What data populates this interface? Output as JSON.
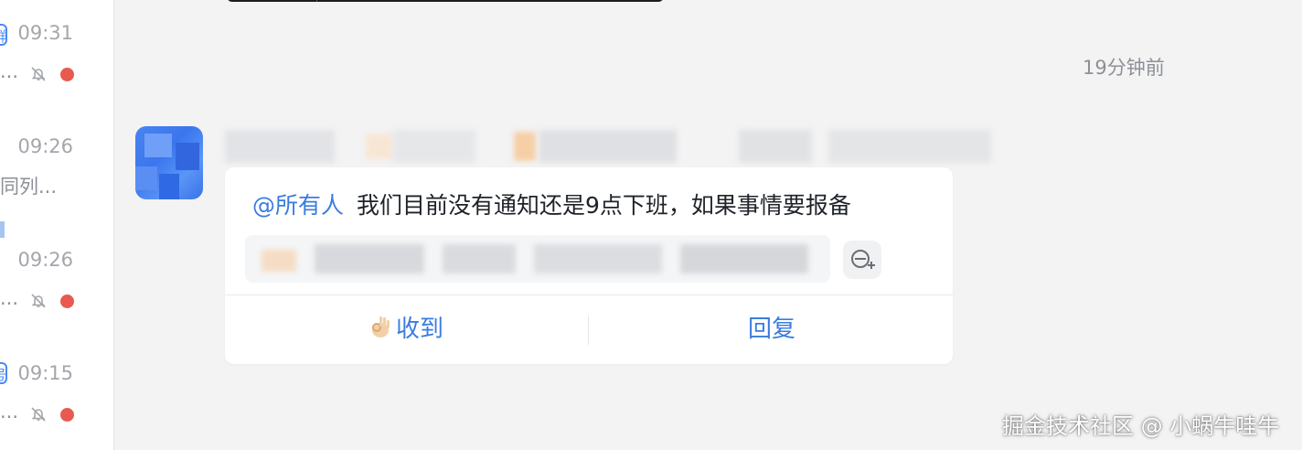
{
  "sidebar": {
    "conversations": [
      {
        "tag": "群",
        "time": "09:31",
        "preview": "..."
      },
      {
        "time": "09:26",
        "preview": "同列..."
      },
      {
        "time": "09:26",
        "preview": "..."
      },
      {
        "tag": "号",
        "time": "09:15",
        "preview": "..."
      }
    ]
  },
  "chat": {
    "relative_time": "19分钟前",
    "message": {
      "mention": "@所有人",
      "text": "我们目前没有通知还是9点下班，如果事情要报备"
    },
    "actions": {
      "received_label": "收到",
      "reply_label": "回复"
    }
  },
  "watermark": "掘金技术社区 @ 小蜗牛哇牛",
  "colors": {
    "accent": "#3a7ce0",
    "unread_dot": "#e85a4f",
    "background": "#f3f3f4"
  },
  "icons": [
    "mute-bell-icon",
    "ok-hand-icon",
    "add-reader-icon"
  ]
}
